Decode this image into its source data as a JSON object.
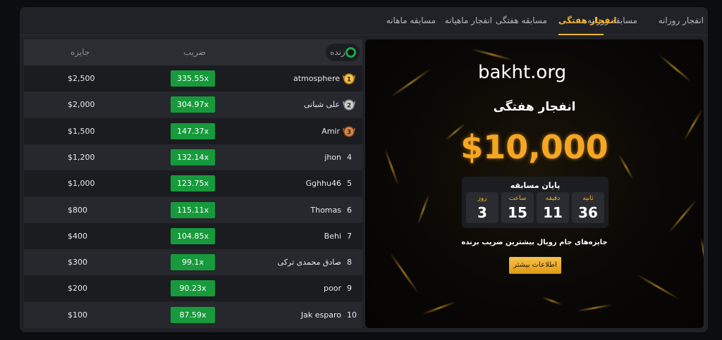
{
  "tabs": [
    "انفجار روزانه",
    "مسابقه روزانه",
    "انفجار هفتگی",
    "مسابقه هفتگی",
    "انفجار ماهیانه",
    "مسابقه ماهانه"
  ],
  "active_tab": "انفجار هفتگی",
  "board": {
    "headers": {
      "live": "زنده",
      "multiplier": "ضریب",
      "prize": "جایزه"
    },
    "rows": [
      {
        "rank": "1",
        "name": "atmosphere",
        "multiplier": "335.55x",
        "prize": "$2,500"
      },
      {
        "rank": "2",
        "name": "علی شبانی",
        "multiplier": "304.97x",
        "prize": "$2,000"
      },
      {
        "rank": "3",
        "name": "Amir",
        "multiplier": "147.37x",
        "prize": "$1,500"
      },
      {
        "rank": "4",
        "name": "jhon",
        "multiplier": "132.14x",
        "prize": "$1,200"
      },
      {
        "rank": "5",
        "name": "Gghhu46",
        "multiplier": "123.75x",
        "prize": "$1,000"
      },
      {
        "rank": "6",
        "name": "Thomas",
        "multiplier": "115.11x",
        "prize": "$800"
      },
      {
        "rank": "7",
        "name": "Behi",
        "multiplier": "104.85x",
        "prize": "$400"
      },
      {
        "rank": "8",
        "name": "صادق محمدی ترکی",
        "multiplier": "99.1x",
        "prize": "$300"
      },
      {
        "rank": "9",
        "name": "poor",
        "multiplier": "90.23x",
        "prize": "$200"
      },
      {
        "rank": "10",
        "name": "Jak esparo",
        "multiplier": "87.59x",
        "prize": "$100"
      }
    ]
  },
  "promo": {
    "site": "bakht.org",
    "title": "انفجار هفتگی",
    "amount": "$10,000",
    "countdown": {
      "title": "پایان مسابقه",
      "units": [
        {
          "label": "روز",
          "value": "3"
        },
        {
          "label": "ساعت",
          "value": "15"
        },
        {
          "label": "دقیقه",
          "value": "11"
        },
        {
          "label": "ثانیه",
          "value": "36"
        }
      ]
    },
    "description": "جایزه‌های جام رویال بیشترین ضریب برنده",
    "button": "اطلاعات بیشتر"
  },
  "colors": {
    "accent": "#f0b429",
    "multiplier_bg": "#179a3c",
    "live_dot": "#1fa847"
  },
  "icons": {
    "live": "live-indicator-icon",
    "medals": [
      "gold-medal-icon",
      "silver-medal-icon",
      "bronze-medal-icon"
    ]
  }
}
